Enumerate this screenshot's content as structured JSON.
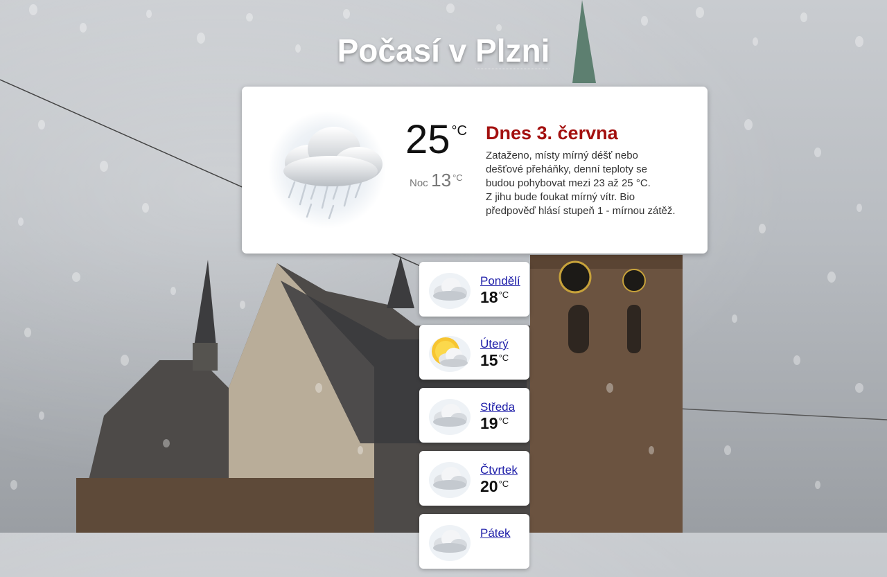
{
  "page": {
    "title_prefix": "Počasí v ",
    "city": "Plzni"
  },
  "today": {
    "icon": "cloud-rain-icon",
    "temp": "25",
    "unit": "°C",
    "night_label": "Noc",
    "night_temp": "13",
    "date": "Dnes 3. června",
    "description_lines": [
      "Zataženo, místy mírný déšť nebo",
      "dešťové přeháňky, denní teploty se",
      "budou pohybovat mezi 23 až 25 °C.",
      "Z jihu bude foukat mírný vítr. Bio",
      "předpověď hlásí stupeň 1 - mírnou zátěž."
    ]
  },
  "forecast": [
    {
      "day": "Pondělí",
      "temp": "18",
      "unit": "°C",
      "icon": "cloud-icon"
    },
    {
      "day": "Úterý",
      "temp": "15",
      "unit": "°C",
      "icon": "sun-cloud-icon"
    },
    {
      "day": "Středa",
      "temp": "19",
      "unit": "°C",
      "icon": "cloud-icon"
    },
    {
      "day": "Čtvrtek",
      "temp": "20",
      "unit": "°C",
      "icon": "cloud-icon"
    },
    {
      "day": "Pátek",
      "temp": "",
      "unit": "",
      "icon": "cloud-icon"
    }
  ],
  "colors": {
    "date_accent": "#a3100f",
    "link": "#1c1ca8"
  }
}
